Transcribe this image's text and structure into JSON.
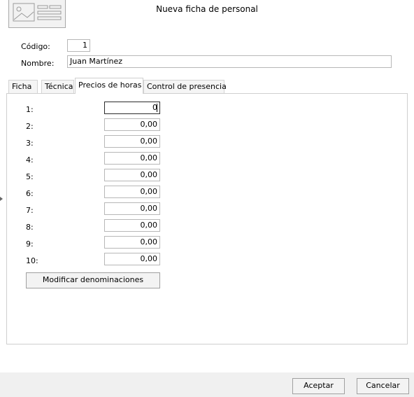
{
  "window": {
    "title": "Nueva ficha de personal"
  },
  "form": {
    "codigo_label": "Código:",
    "codigo_value": "1",
    "nombre_label": "Nombre:",
    "nombre_value": "Juan Martínez"
  },
  "tabs": [
    {
      "label": "Ficha"
    },
    {
      "label": "Técnica"
    },
    {
      "label": "Precios de horas",
      "active": true
    },
    {
      "label": "Control de presencia"
    }
  ],
  "prices": [
    {
      "label": "1:",
      "value": "0"
    },
    {
      "label": "2:",
      "value": "0,00"
    },
    {
      "label": "3:",
      "value": "0,00"
    },
    {
      "label": "4:",
      "value": "0,00"
    },
    {
      "label": "5:",
      "value": "0,00"
    },
    {
      "label": "6:",
      "value": "0,00"
    },
    {
      "label": "7:",
      "value": "0,00"
    },
    {
      "label": "8:",
      "value": "0,00"
    },
    {
      "label": "9:",
      "value": "0,00"
    },
    {
      "label": "10:",
      "value": "0,00"
    }
  ],
  "buttons": {
    "modificar": "Modificar denominaciones",
    "aceptar": "Aceptar",
    "cancelar": "Cancelar"
  },
  "icons": {
    "photo": "photo-placeholder-icon",
    "edge": "left-edge-arrow-icon"
  }
}
